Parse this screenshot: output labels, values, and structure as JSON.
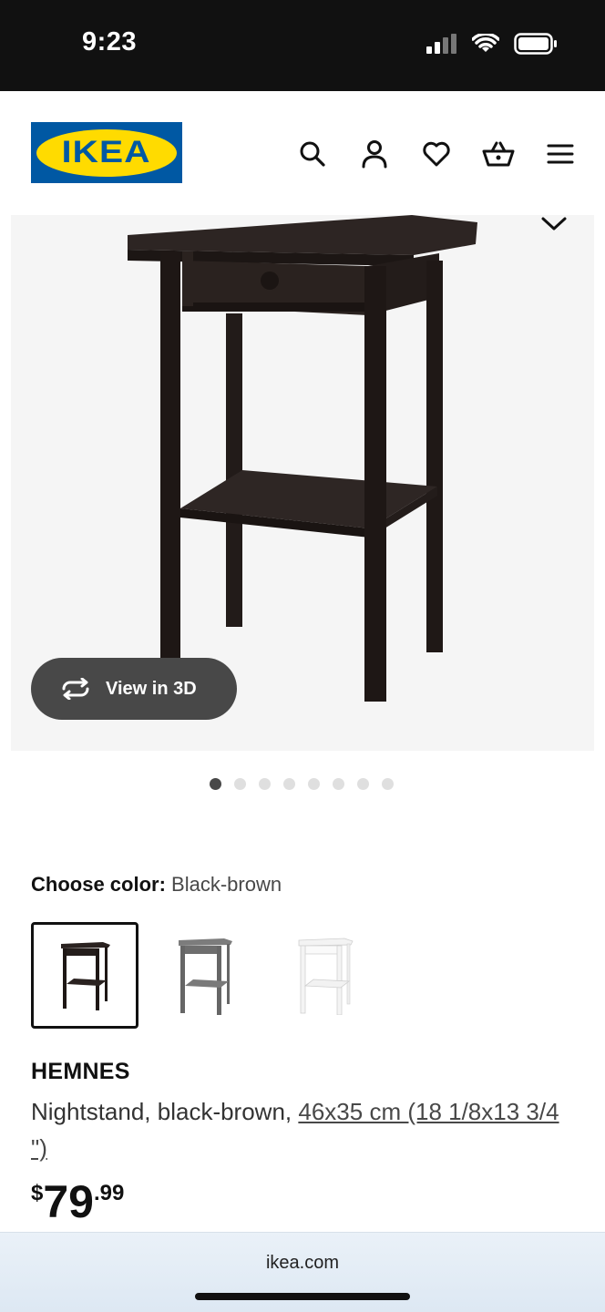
{
  "status_bar": {
    "time": "9:23"
  },
  "header": {
    "logo_text": "IKEA",
    "icons": [
      "search-icon",
      "account-icon",
      "heart-icon",
      "cart-icon",
      "menu-icon"
    ]
  },
  "gallery": {
    "view3d_label": "View in 3D",
    "dots_count": 8,
    "active_dot": 0
  },
  "color": {
    "label": "Choose color:",
    "selected": "Black-brown",
    "swatches": [
      "black-brown",
      "gray",
      "white"
    ]
  },
  "product": {
    "name": "HEMNES",
    "desc_prefix": "Nightstand, black-brown, ",
    "dimensions_link": "46x35 cm (18 1/8x13 3/4 \")",
    "price_currency": "$",
    "price_int": "79",
    "price_dec": ".99"
  },
  "browser": {
    "url": "ikea.com"
  },
  "colors": {
    "brand_blue": "#0058a3",
    "brand_yellow": "#ffdb00",
    "pill": "#484848"
  }
}
